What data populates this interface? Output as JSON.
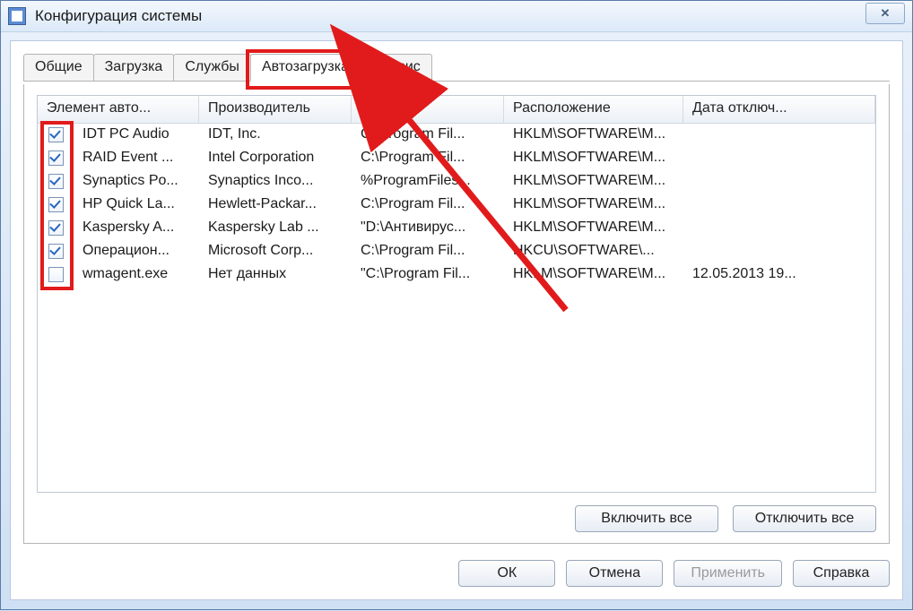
{
  "window": {
    "title": "Конфигурация системы",
    "close_glyph": "✕"
  },
  "tabs": [
    {
      "id": "general",
      "label": "Общие"
    },
    {
      "id": "boot",
      "label": "Загрузка"
    },
    {
      "id": "services",
      "label": "Службы"
    },
    {
      "id": "startup",
      "label": "Автозагрузка"
    },
    {
      "id": "tools",
      "label": "Сервис"
    }
  ],
  "active_tab": "startup",
  "columns": {
    "item": "Элемент авто...",
    "manufacturer": "Производитель",
    "command": "Команда",
    "location": "Расположение",
    "date_disabled": "Дата отключ..."
  },
  "rows": [
    {
      "checked": true,
      "item": "IDT PC Audio",
      "manufacturer": "IDT, Inc.",
      "command": "C:\\Program Fil...",
      "location": "HKLM\\SOFTWARE\\M...",
      "date": ""
    },
    {
      "checked": true,
      "item": "RAID Event ...",
      "manufacturer": "Intel Corporation",
      "command": "C:\\Program Fil...",
      "location": "HKLM\\SOFTWARE\\M...",
      "date": ""
    },
    {
      "checked": true,
      "item": "Synaptics Po...",
      "manufacturer": "Synaptics Inco...",
      "command": "%ProgramFiles...",
      "location": "HKLM\\SOFTWARE\\M...",
      "date": ""
    },
    {
      "checked": true,
      "item": "HP Quick La...",
      "manufacturer": "Hewlett-Packar...",
      "command": "C:\\Program Fil...",
      "location": "HKLM\\SOFTWARE\\M...",
      "date": ""
    },
    {
      "checked": true,
      "item": "Kaspersky A...",
      "manufacturer": "Kaspersky Lab ...",
      "command": "\"D:\\Антивирус...",
      "location": "HKLM\\SOFTWARE\\M...",
      "date": ""
    },
    {
      "checked": true,
      "item": "Операцион...",
      "manufacturer": "Microsoft Corp...",
      "command": "C:\\Program Fil...",
      "location": "HKCU\\SOFTWARE\\...",
      "date": ""
    },
    {
      "checked": false,
      "item": "wmagent.exe",
      "manufacturer": "Нет данных",
      "command": "\"C:\\Program Fil...",
      "location": "HKLM\\SOFTWARE\\M...",
      "date": "12.05.2013 19..."
    }
  ],
  "panel_buttons": {
    "enable_all": "Включить все",
    "disable_all": "Отключить все"
  },
  "dialog_buttons": {
    "ok": "ОК",
    "cancel": "Отмена",
    "apply": "Применить",
    "help": "Справка"
  }
}
